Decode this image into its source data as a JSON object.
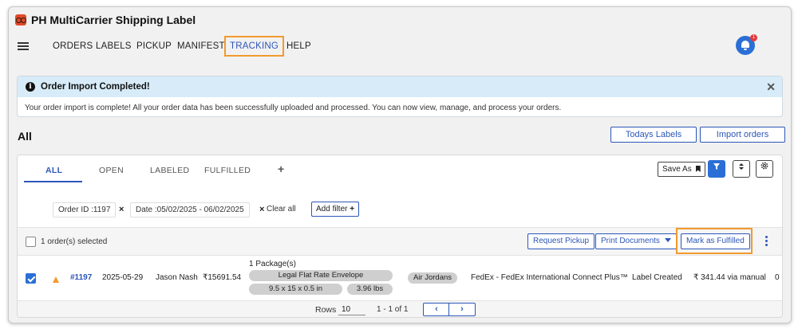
{
  "app": {
    "title": "PH MultiCarrier Shipping Label"
  },
  "nav": {
    "items": [
      "ORDERS",
      "LABELS",
      "PICKUP",
      "MANIFEST",
      "TRACKING",
      "HELP"
    ],
    "notification_count": "1"
  },
  "alert": {
    "title": "Order Import Completed!",
    "message": "Your order import is complete! All your order data has been successfully uploaded and processed. You can now view, manage, and process your orders.",
    "close_glyph": "✕"
  },
  "section": {
    "title": "All",
    "todays_labels": "Todays Labels",
    "import_orders": "Import orders"
  },
  "tabs": {
    "items": [
      "ALL",
      "OPEN",
      "LABELED",
      "FULFILLED"
    ],
    "add_glyph": "+",
    "save_as": "Save As"
  },
  "filters": {
    "order_id": "Order ID :1197",
    "date": "Date :05/02/2025 - 06/02/2025",
    "clear_all": "Clear all",
    "add_filter": "Add filter",
    "remove_glyph": "×"
  },
  "toolbar": {
    "selected": "1 order(s) selected",
    "request_pickup": "Request Pickup",
    "print_documents": "Print Documents",
    "mark_fulfilled": "Mark as Fulfilled"
  },
  "order": {
    "id": "#1197",
    "date": "2025-05-29",
    "customer": "Jason Nash",
    "amount": "₹15691.54",
    "packages": "1 Package(s)",
    "package_type": "Legal Flat Rate Envelope",
    "dimensions": "9.5 x 15 x 0.5 in",
    "weight": "3.96 lbs",
    "product": "Air Jordans",
    "service": "FedEx - FedEx International Connect Plus™",
    "status": "Label Created",
    "shipping_cost": "₹ 341.44 via manual",
    "extra": "0"
  },
  "pagination": {
    "rows_label": "Rows",
    "rows_value": "10",
    "range": "1 - 1 of 1",
    "prev": "‹",
    "next": "›"
  },
  "colors": {
    "accent": "#2d56b8",
    "highlight": "#f29a2e",
    "alert_bg": "#d7ecf8",
    "bell": "#2b6fd6"
  }
}
